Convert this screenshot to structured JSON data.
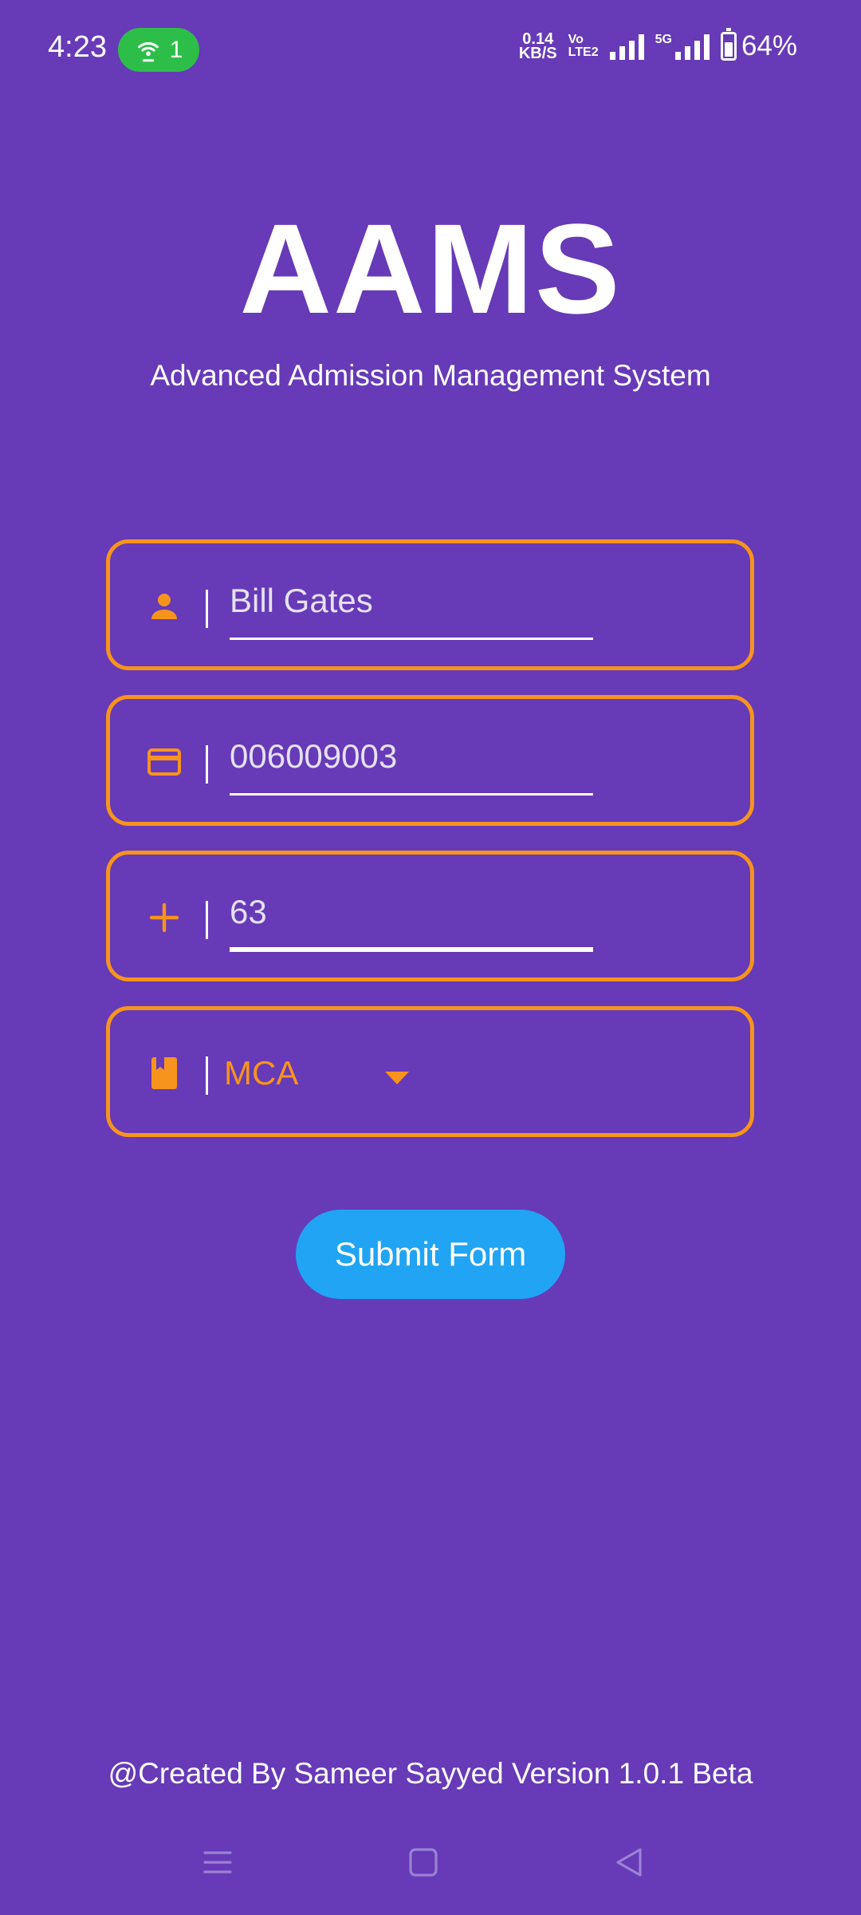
{
  "status_bar": {
    "time": "4:23",
    "hotspot_count": "1",
    "net_speed_value": "0.14",
    "net_speed_unit": "KB/S",
    "volte_top": "Vo",
    "volte_bottom": "LTE2",
    "network": "5G",
    "battery": "64%"
  },
  "header": {
    "title": "AAMS",
    "subtitle": "Advanced Admission Management System"
  },
  "form": {
    "name": {
      "icon": "person-icon",
      "value": "Bill Gates"
    },
    "id": {
      "icon": "card-icon",
      "value": "006009003"
    },
    "marks": {
      "icon": "plus-icon",
      "value": "63"
    },
    "course": {
      "icon": "book-icon",
      "value": "MCA"
    }
  },
  "submit_label": "Submit Form",
  "footer": "@Created By Sameer Sayyed Version 1.0.1 Beta",
  "colors": {
    "background": "#673AB7",
    "accent": "#F7941D",
    "button": "#20A4F3"
  }
}
